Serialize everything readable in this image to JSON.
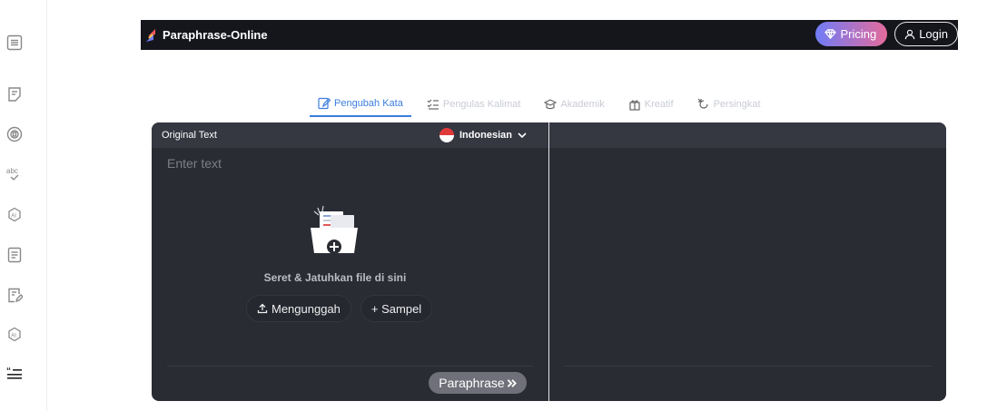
{
  "sidebar": {
    "icons": [
      "menu-icon",
      "note-icon",
      "reference-icon",
      "spellcheck-icon",
      "ai-detector-icon",
      "document-icon",
      "edit-document-icon",
      "ai-humanizer-icon",
      "quote-list-icon"
    ]
  },
  "header": {
    "brand": "Paraphrase-Online",
    "pricing_label": "Pricing",
    "login_label": "Login"
  },
  "tabs": [
    {
      "label": "Pengubah Kata",
      "active": true
    },
    {
      "label": "Pengulas Kalimat",
      "active": false
    },
    {
      "label": "Akademik",
      "active": false
    },
    {
      "label": "Kreatif",
      "active": false
    },
    {
      "label": "Persingkat",
      "active": false
    }
  ],
  "editor": {
    "left_title": "Original Text",
    "language": "Indonesian",
    "placeholder": "Enter text",
    "drop_text": "Seret & Jatuhkan file di sini",
    "upload_label": "Mengunggah",
    "sample_label": "+ Sampel",
    "paraphrase_label": "Paraphrase"
  },
  "colors": {
    "topbar": "#15161c",
    "editor_bg": "#2a2c33",
    "accent_blue": "#3b7de0",
    "pricing_gradient_start": "#6f7cf7",
    "pricing_gradient_end": "#e46b9b"
  }
}
